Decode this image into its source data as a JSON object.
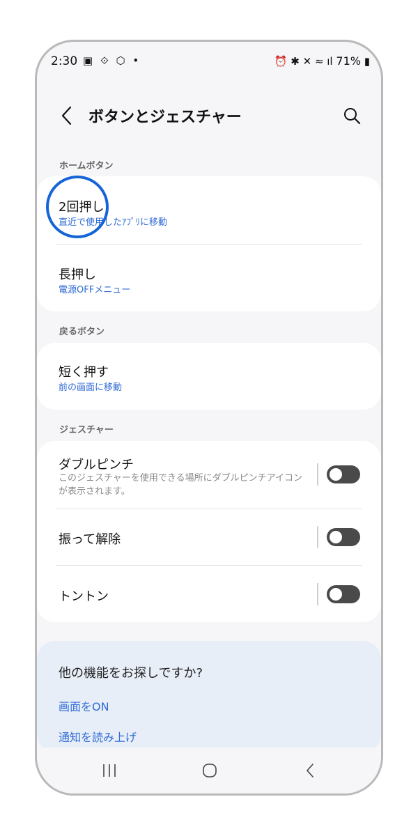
{
  "status": {
    "time": "2:30",
    "left_icons": "▣ ⟐ ⬡ •",
    "right_icons": "⏰ ✱ ✕ ≈ ıl",
    "battery": "71%"
  },
  "header": {
    "title": "ボタンとジェスチャー"
  },
  "sections": {
    "home_button": "ホームボタン",
    "back_button": "戻るボタン",
    "gestures": "ジェスチャー"
  },
  "home_items": [
    {
      "title": "2回押し",
      "subtitle": "直近で使用したｱﾌﾟﾘに移動"
    },
    {
      "title": "長押し",
      "subtitle": "電源OFFメニュー"
    }
  ],
  "back_items": [
    {
      "title": "短く押す",
      "subtitle": "前の画面に移動"
    }
  ],
  "gesture_items": [
    {
      "title": "ダブルピンチ",
      "desc": "このジェスチャーを使用できる場所にダブルピンチアイコンが表示されます。",
      "enabled": false
    },
    {
      "title": "振って解除",
      "enabled": false
    },
    {
      "title": "トントン",
      "enabled": false
    }
  ],
  "more": {
    "title": "他の機能をお探しですか?",
    "links": [
      "画面をON",
      "通知を読み上げ"
    ]
  }
}
